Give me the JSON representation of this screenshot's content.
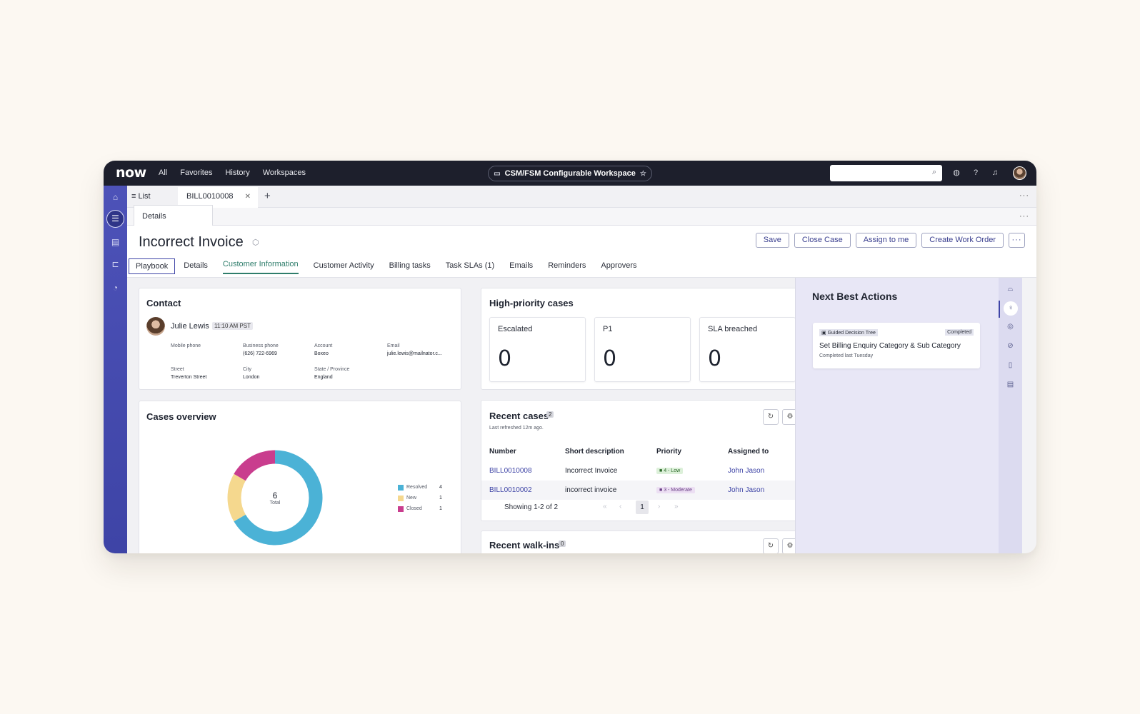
{
  "topbar": {
    "logo": "now",
    "nav": [
      "All",
      "Favorites",
      "History",
      "Workspaces"
    ],
    "workspace": "CSM/FSM Configurable Workspace",
    "search_placeholder": ""
  },
  "tabs": {
    "list_label": "List",
    "record_tab": "BILL0010008",
    "sub_tab": "Details"
  },
  "record": {
    "title": "Incorrect Invoice",
    "actions": [
      "Save",
      "Close Case",
      "Assign to me",
      "Create Work Order"
    ],
    "tabs": [
      "Playbook",
      "Details",
      "Customer Information",
      "Customer Activity",
      "Billing tasks",
      "Task SLAs (1)",
      "Emails",
      "Reminders",
      "Approvers"
    ],
    "active_tab": "Customer Information"
  },
  "contact": {
    "heading": "Contact",
    "name": "Julie Lewis",
    "local_time": "11:10 AM PST",
    "fields": [
      {
        "label": "Mobile phone",
        "value": ""
      },
      {
        "label": "Business phone",
        "value": "(626) 722-6969"
      },
      {
        "label": "Account",
        "value": "Boxeo"
      },
      {
        "label": "Email",
        "value": "julie.lewis@mailnator.c..."
      },
      {
        "label": "Street",
        "value": "Treverton Street"
      },
      {
        "label": "City",
        "value": "London"
      },
      {
        "label": "State / Province",
        "value": "England"
      }
    ]
  },
  "high_priority": {
    "heading": "High-priority cases",
    "tiles": [
      {
        "label": "Escalated",
        "value": "0"
      },
      {
        "label": "P1",
        "value": "0"
      },
      {
        "label": "SLA breached",
        "value": "0"
      }
    ]
  },
  "cases_overview": {
    "heading": "Cases overview",
    "total_value": "6",
    "total_label": "Total"
  },
  "chart_data": {
    "type": "pie",
    "donut": true,
    "categories": [
      "Resolved",
      "New",
      "Closed"
    ],
    "values": [
      4,
      1,
      1
    ],
    "colors": [
      "#4bb2d6",
      "#f5d88e",
      "#c93d8e"
    ],
    "center_value": 6,
    "center_label": "Total",
    "legend": "right"
  },
  "recent_cases": {
    "heading": "Recent cases",
    "count": "2",
    "refreshed": "Last refreshed 12m ago.",
    "columns": [
      "Number",
      "Short description",
      "Priority",
      "Assigned to"
    ],
    "rows": [
      {
        "number": "BILL0010008",
        "description": "Incorrect Invoice",
        "priority": "4 - Low",
        "assigned": "John Jason"
      },
      {
        "number": "BILL0010002",
        "description": "incorrect invoice",
        "priority": "3 - Moderate",
        "assigned": "John Jason"
      }
    ],
    "showing": "Showing 1-2 of 2",
    "page": "1"
  },
  "recent_walkins": {
    "heading": "Recent walk-ins",
    "count": "0"
  },
  "next_best_actions": {
    "heading": "Next Best Actions",
    "card": {
      "type": "Guided Decision Tree",
      "status": "Completed",
      "title": "Set Billing Enquiry Category & Sub Category",
      "subtitle": "Completed last Tuesday"
    }
  },
  "icons": {
    "left_rail": [
      "home-icon",
      "list-icon",
      "inbox-icon",
      "tree-icon",
      "analytics-icon"
    ],
    "right_rail": [
      "grad-cap-icon",
      "lightbulb-icon",
      "globe-icon",
      "attachment-icon",
      "document-icon",
      "article-icon"
    ]
  }
}
